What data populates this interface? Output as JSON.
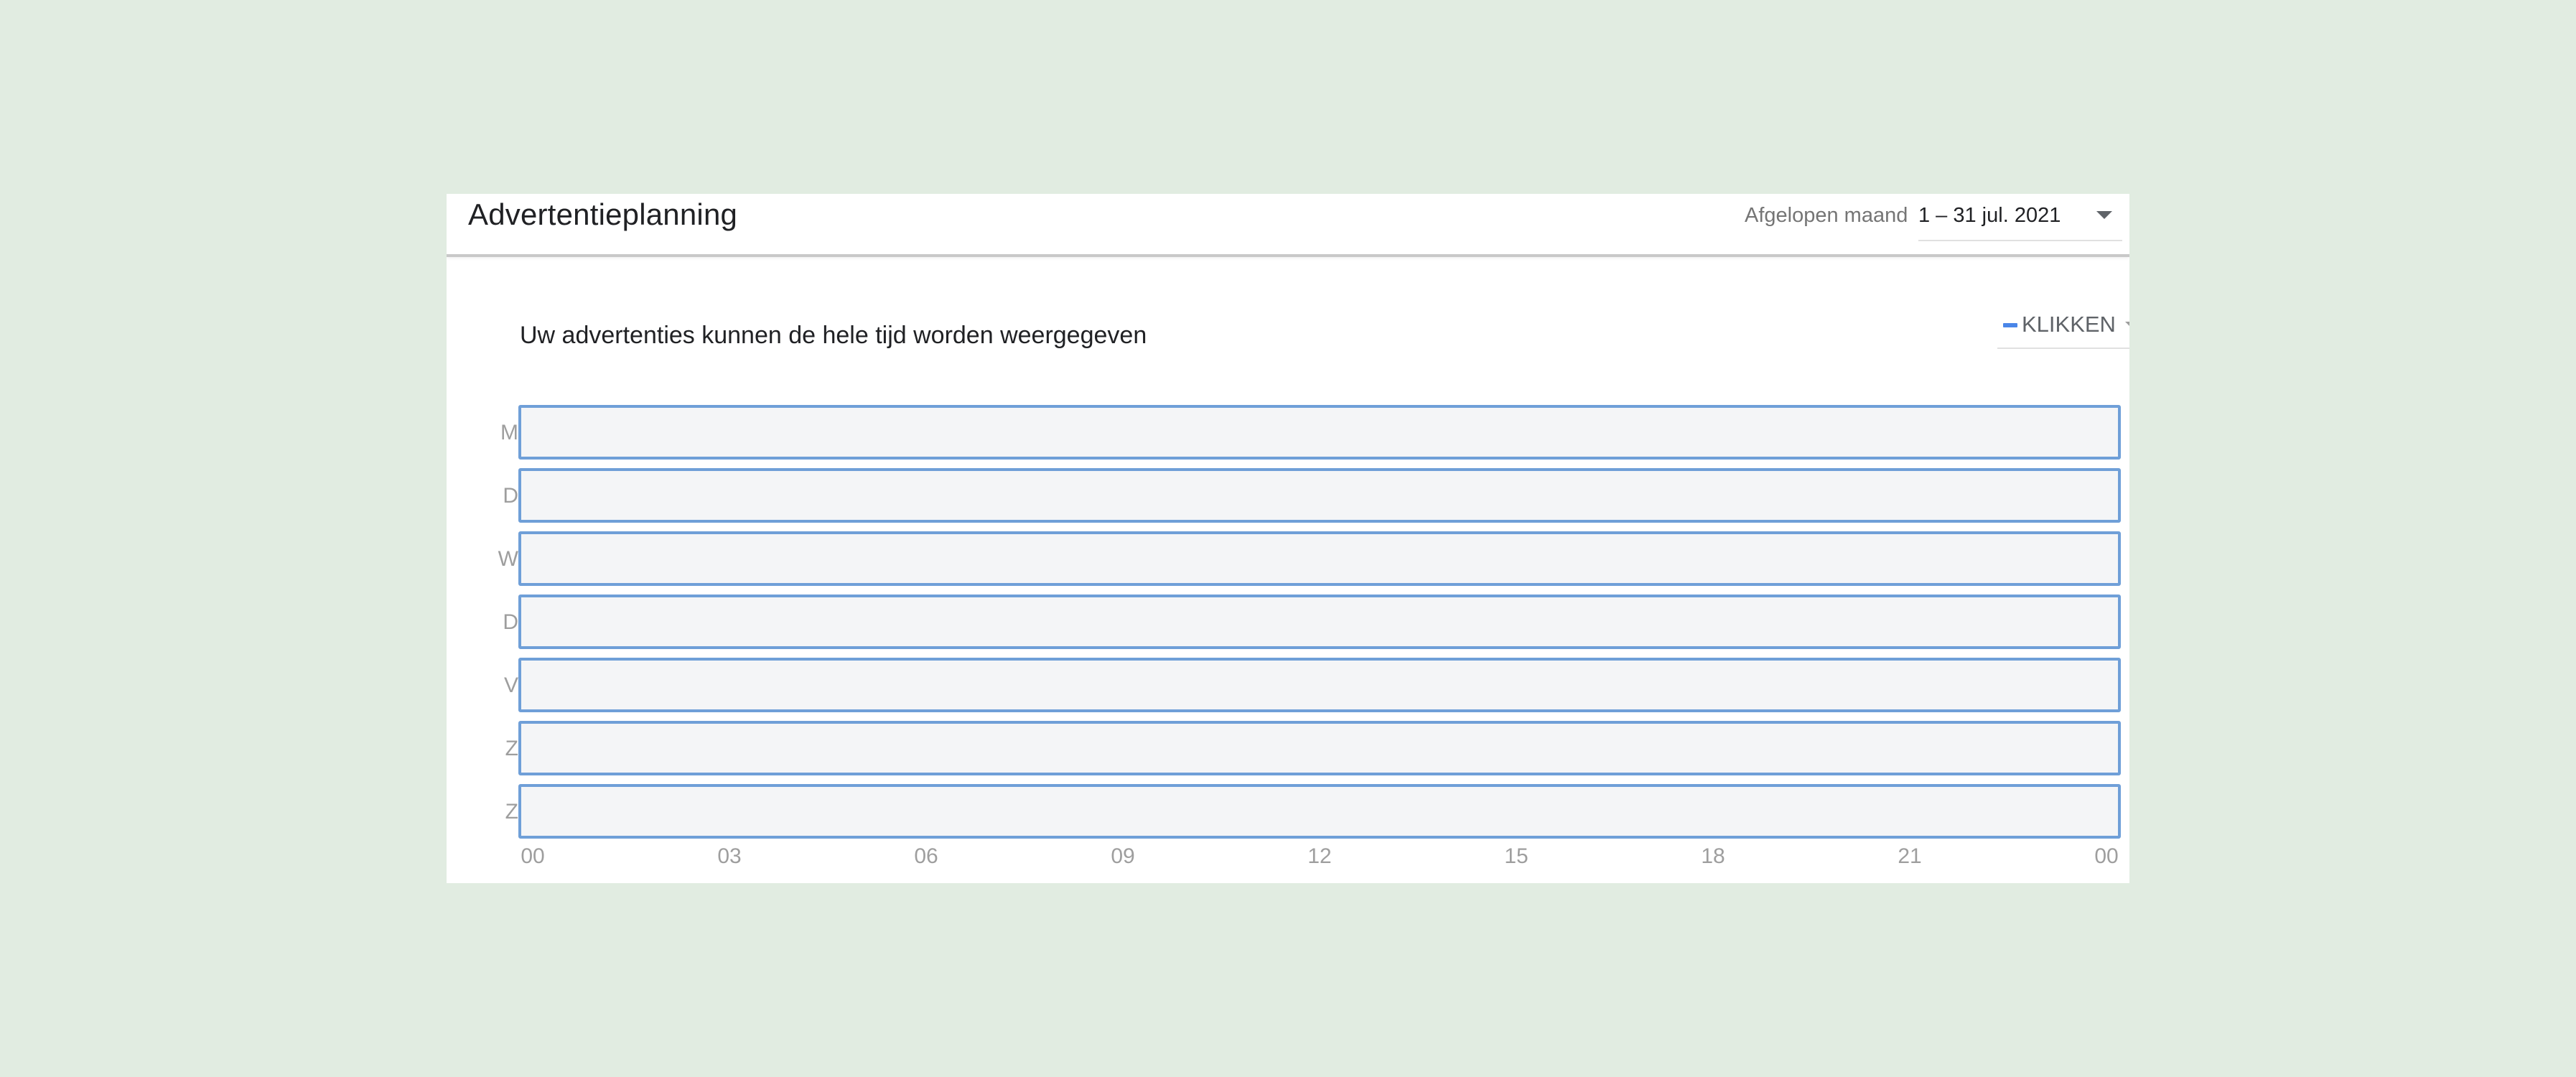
{
  "header": {
    "title": "Advertentieplanning",
    "range_label": "Afgelopen maand",
    "range_value": "1 – 31 jul. 2021"
  },
  "chart_header": {
    "subtitle": "Uw advertenties kunnen de hele tijd worden weergegeven",
    "metric": "KLIKKEN",
    "metric_color": "#4a86e8"
  },
  "chart_data": {
    "type": "heatmap",
    "rows": [
      "M",
      "D",
      "W",
      "D",
      "V",
      "Z",
      "Z"
    ],
    "x_ticks": [
      "00",
      "03",
      "06",
      "09",
      "12",
      "15",
      "18",
      "21",
      "00"
    ],
    "schedule": "all-time",
    "bar_color": "#6f9fd8",
    "fill_color": "#f4f5f7"
  }
}
